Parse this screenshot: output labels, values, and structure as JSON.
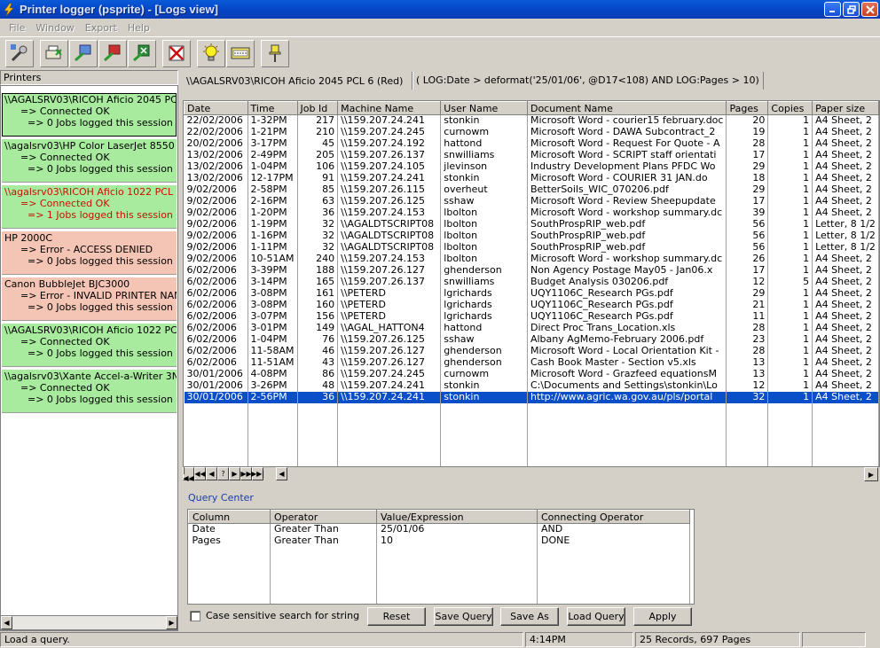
{
  "window": {
    "title": "Printer logger (psprite) - [Logs view]"
  },
  "menu": [
    "File",
    "Window",
    "Export",
    "Help"
  ],
  "printers": {
    "header": "Printers",
    "entries": [
      {
        "name": "\\\\AGALSRV03\\RICOH Aficio 2045 PCL",
        "status": "=> Connected OK",
        "jobs": "=> 0 Jobs logged this session",
        "style": "ok",
        "selected": true
      },
      {
        "name": "\\\\agalsrv03\\HP Color LaserJet 8550 PS",
        "status": "=> Connected OK",
        "jobs": "=> 0 Jobs logged this session",
        "style": "ok"
      },
      {
        "name": "\\\\agalsrv03\\RICOH Aficio 1022 PCL 6 (",
        "status": "=> Connected OK",
        "jobs": "=> 1 Jobs logged this session",
        "style": "okred"
      },
      {
        "name": "HP 2000C",
        "status": "=> Error - ACCESS DENIED",
        "jobs": "=> 0 Jobs logged this session",
        "style": "err"
      },
      {
        "name": "Canon BubbleJet BJC3000",
        "status": "=> Error - INVALID PRINTER NAME",
        "jobs": "=> 0 Jobs logged this session",
        "style": "err"
      },
      {
        "name": "\\\\AGALSRV03\\RICOH Aficio 1022 PCL",
        "status": "=> Connected OK",
        "jobs": "=> 0 Jobs logged this session",
        "style": "ok"
      },
      {
        "name": "\\\\agalsrv03\\Xante Accel-a-Writer 3N (X",
        "status": "=> Connected OK",
        "jobs": "=> 0 Jobs logged this session",
        "style": "ok"
      }
    ]
  },
  "log_view": {
    "printer_path": "\\\\AGALSRV03\\RICOH Aficio 2045 PCL 6 (Red)",
    "query_text": "( LOG:Date > deformat('25/01/06', @D17<108) AND LOG:Pages > 10)",
    "columns": [
      "Date",
      "Time",
      "Job Id",
      "Machine Name",
      "User Name",
      "Document Name",
      "Pages",
      "Copies",
      "Paper size"
    ],
    "rows": [
      [
        "22/02/2006",
        "1-32PM",
        "217",
        "\\\\159.207.24.241",
        "stonkin",
        "Microsoft Word - courier15 february.doc",
        "20",
        "1",
        "A4 Sheet, 2"
      ],
      [
        "22/02/2006",
        "1-21PM",
        "210",
        "\\\\159.207.24.245",
        "curnowm",
        "Microsoft Word - DAWA Subcontract_2",
        "19",
        "1",
        "A4 Sheet, 2"
      ],
      [
        "20/02/2006",
        "3-17PM",
        "45",
        "\\\\159.207.24.192",
        "hattond",
        "Microsoft Word - Request For Quote - A",
        "28",
        "1",
        "A4 Sheet, 2"
      ],
      [
        "13/02/2006",
        "2-49PM",
        "205",
        "\\\\159.207.26.137",
        "snwilliams",
        "Microsoft Word - SCRIPT staff orientati",
        "17",
        "1",
        "A4 Sheet, 2"
      ],
      [
        "13/02/2006",
        "1-04PM",
        "106",
        "\\\\159.207.24.105",
        "jlevinson",
        "Industry Development Plans PFDC Wo",
        "29",
        "1",
        "A4 Sheet, 2"
      ],
      [
        "13/02/2006",
        "12-17PM",
        "91",
        "\\\\159.207.24.241",
        "stonkin",
        "Microsoft Word - COURIER 31 JAN.do",
        "18",
        "1",
        "A4 Sheet, 2"
      ],
      [
        "9/02/2006",
        "2-58PM",
        "85",
        "\\\\159.207.26.115",
        "overheut",
        "BetterSoils_WIC_070206.pdf",
        "29",
        "1",
        "A4 Sheet, 2"
      ],
      [
        "9/02/2006",
        "2-16PM",
        "63",
        "\\\\159.207.26.125",
        "sshaw",
        "Microsoft Word - Review Sheepupdate",
        "17",
        "1",
        "A4 Sheet, 2"
      ],
      [
        "9/02/2006",
        "1-20PM",
        "36",
        "\\\\159.207.24.153",
        "lbolton",
        "Microsoft Word - workshop summary.dc",
        "39",
        "1",
        "A4 Sheet, 2"
      ],
      [
        "9/02/2006",
        "1-19PM",
        "32",
        "\\\\AGALDTSCRIPT08",
        "lbolton",
        "SouthProspRIP_web.pdf",
        "56",
        "1",
        "Letter, 8 1/2"
      ],
      [
        "9/02/2006",
        "1-16PM",
        "32",
        "\\\\AGALDTSCRIPT08",
        "lbolton",
        "SouthProspRIP_web.pdf",
        "56",
        "1",
        "Letter, 8 1/2"
      ],
      [
        "9/02/2006",
        "1-11PM",
        "32",
        "\\\\AGALDTSCRIPT08",
        "lbolton",
        "SouthProspRIP_web.pdf",
        "56",
        "1",
        "Letter, 8 1/2"
      ],
      [
        "9/02/2006",
        "10-51AM",
        "240",
        "\\\\159.207.24.153",
        "lbolton",
        "Microsoft Word - workshop summary.dc",
        "26",
        "1",
        "A4 Sheet, 2"
      ],
      [
        "6/02/2006",
        "3-39PM",
        "188",
        "\\\\159.207.26.127",
        "ghenderson",
        "Non Agency Postage May05 - Jan06.x",
        "17",
        "1",
        "A4 Sheet, 2"
      ],
      [
        "6/02/2006",
        "3-14PM",
        "165",
        "\\\\159.207.26.137",
        "snwilliams",
        "Budget Analysis 030206.pdf",
        "12",
        "5",
        "A4 Sheet, 2"
      ],
      [
        "6/02/2006",
        "3-08PM",
        "161",
        "\\\\PETERD",
        "lgrichards",
        "UQY1106C_Research PGs.pdf",
        "29",
        "1",
        "A4 Sheet, 2"
      ],
      [
        "6/02/2006",
        "3-08PM",
        "160",
        "\\\\PETERD",
        "lgrichards",
        "UQY1106C_Research PGs.pdf",
        "21",
        "1",
        "A4 Sheet, 2"
      ],
      [
        "6/02/2006",
        "3-07PM",
        "156",
        "\\\\PETERD",
        "lgrichards",
        "UQY1106C_Research PGs.pdf",
        "11",
        "1",
        "A4 Sheet, 2"
      ],
      [
        "6/02/2006",
        "3-01PM",
        "149",
        "\\\\AGAL_HATTON4",
        "hattond",
        "Direct Proc Trans_Location.xls",
        "28",
        "1",
        "A4 Sheet, 2"
      ],
      [
        "6/02/2006",
        "1-04PM",
        "76",
        "\\\\159.207.26.125",
        "sshaw",
        "Albany AgMemo-February 2006.pdf",
        "23",
        "1",
        "A4 Sheet, 2"
      ],
      [
        "6/02/2006",
        "11-58AM",
        "46",
        "\\\\159.207.26.127",
        "ghenderson",
        "Microsoft Word - Local Orientation Kit -",
        "28",
        "1",
        "A4 Sheet, 2"
      ],
      [
        "6/02/2006",
        "11-51AM",
        "43",
        "\\\\159.207.26.127",
        "ghenderson",
        "Cash Book Master - Section v5.xls",
        "13",
        "1",
        "A4 Sheet, 2"
      ],
      [
        "30/01/2006",
        "4-08PM",
        "86",
        "\\\\159.207.24.245",
        "curnowm",
        "Microsoft Word - Grazfeed equationsM",
        "13",
        "1",
        "A4 Sheet, 2"
      ],
      [
        "30/01/2006",
        "3-26PM",
        "48",
        "\\\\159.207.24.241",
        "stonkin",
        "C:\\Documents and Settings\\stonkin\\Lo",
        "12",
        "1",
        "A4 Sheet, 2"
      ],
      [
        "30/01/2006",
        "2-56PM",
        "36",
        "\\\\159.207.24.241",
        "stonkin",
        "http://www.agric.wa.gov.au/pls/portal",
        "32",
        "1",
        "A4 Sheet, 2"
      ]
    ],
    "selected_row": 24,
    "nav_buttons": [
      "|◀◀",
      "◀◀",
      "◀",
      "?",
      "▶",
      "▶▶",
      "▶▶|"
    ]
  },
  "query_center": {
    "title": "Query Center",
    "columns": [
      "Column",
      "Operator",
      "Value/Expression",
      "Connecting Operator"
    ],
    "rows": [
      [
        "Date",
        "Greater Than",
        "25/01/06",
        "AND"
      ],
      [
        "Pages",
        "Greater Than",
        "10",
        "DONE"
      ]
    ],
    "case_sensitive_label": "Case sensitive search for string",
    "buttons": {
      "reset": "Reset",
      "save_query": "Save Query",
      "save_as": "Save As",
      "load_query": "Load Query",
      "apply": "Apply"
    }
  },
  "status_bar": {
    "message": "Load a query.",
    "time": "4:14PM",
    "summary": "25 Records, 697 Pages"
  }
}
